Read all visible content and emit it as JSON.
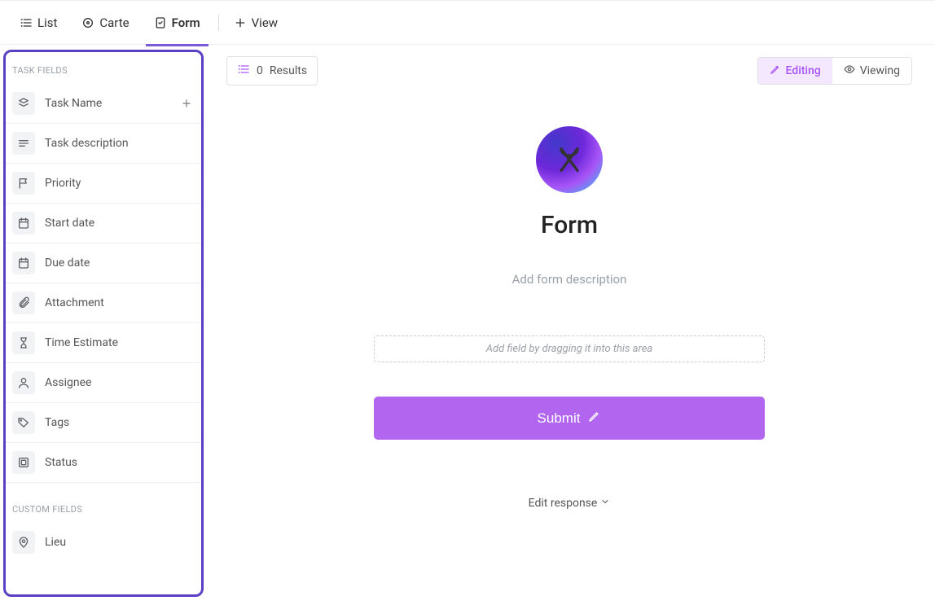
{
  "tabs": {
    "list": "List",
    "carte": "Carte",
    "form": "Form",
    "view": "View"
  },
  "sidebar": {
    "task_fields_label": "TASK FIELDS",
    "custom_fields_label": "CUSTOM FIELDS",
    "fields": [
      {
        "label": "Task Name",
        "icon": "stack"
      },
      {
        "label": "Task description",
        "icon": "text"
      },
      {
        "label": "Priority",
        "icon": "flag"
      },
      {
        "label": "Start date",
        "icon": "calendar"
      },
      {
        "label": "Due date",
        "icon": "calendar"
      },
      {
        "label": "Attachment",
        "icon": "paperclip"
      },
      {
        "label": "Time Estimate",
        "icon": "hourglass"
      },
      {
        "label": "Assignee",
        "icon": "user"
      },
      {
        "label": "Tags",
        "icon": "tag"
      },
      {
        "label": "Status",
        "icon": "square"
      }
    ],
    "custom_fields": [
      {
        "label": "Lieu",
        "icon": "pin"
      }
    ]
  },
  "toolbar": {
    "results_count": "0",
    "results_label": "Results",
    "editing": "Editing",
    "viewing": "Viewing"
  },
  "form": {
    "title": "Form",
    "description_placeholder": "Add form description",
    "dropzone": "Add field by dragging it into this area",
    "submit": "Submit",
    "edit_response": "Edit response"
  },
  "colors": {
    "accent": "#7b5cd6",
    "submit": "#b266f0",
    "editing_bg": "#f3e8ff",
    "editing_fg": "#a855f7"
  }
}
